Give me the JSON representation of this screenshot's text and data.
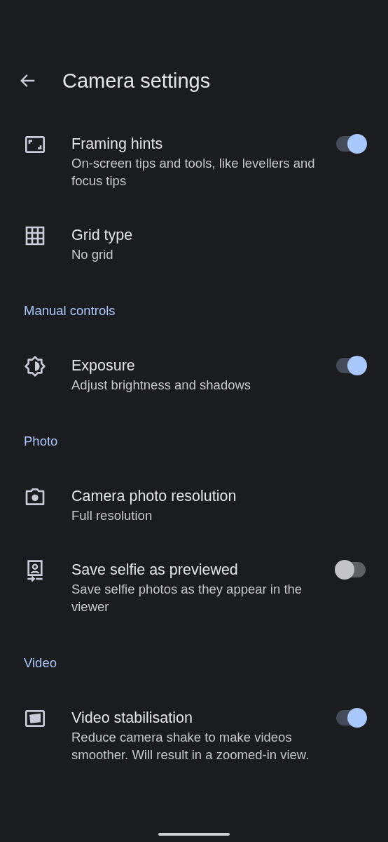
{
  "app_bar": {
    "title": "Camera settings"
  },
  "items": [
    {
      "kind": "switch",
      "title": "Framing hints",
      "subtitle": "On-screen tips and tools, like levellers and focus tips",
      "on": true
    },
    {
      "kind": "option",
      "title": "Grid type",
      "subtitle": "No grid"
    },
    {
      "kind": "header",
      "title": "Manual controls"
    },
    {
      "kind": "switch",
      "title": "Exposure",
      "subtitle": "Adjust brightness and shadows",
      "on": true
    },
    {
      "kind": "header",
      "title": "Photo"
    },
    {
      "kind": "option",
      "title": "Camera photo resolution",
      "subtitle": "Full resolution"
    },
    {
      "kind": "switch",
      "title": "Save selfie as previewed",
      "subtitle": "Save selfie photos as they appear in the viewer",
      "on": false
    },
    {
      "kind": "header",
      "title": "Video"
    },
    {
      "kind": "switch",
      "title": "Video stabilisation",
      "subtitle": "Reduce camera shake to make videos smoother. Will result in a zoomed-in view.",
      "on": true
    }
  ]
}
